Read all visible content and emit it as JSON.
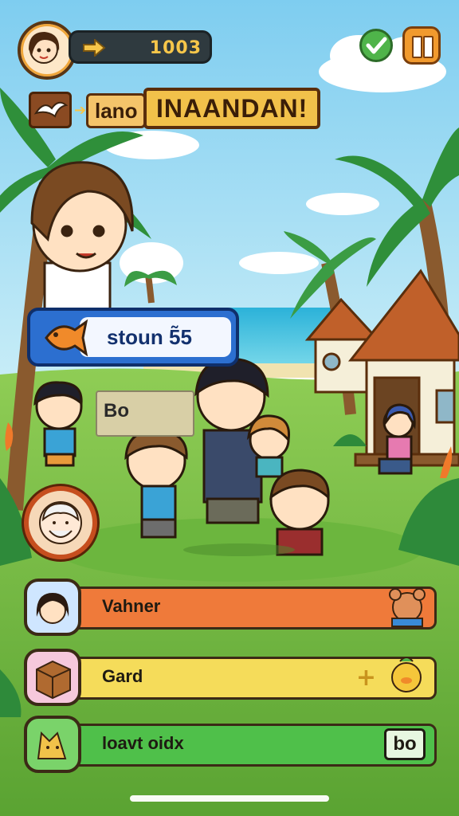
{
  "hud": {
    "coins": "1003",
    "arrow_icon": "arrow-right-icon",
    "confirm_icon": "check-icon",
    "pause_icon": "pause-icon"
  },
  "banner": {
    "subtitle": "lano",
    "title": "INAANDAN!"
  },
  "dialog": {
    "text": "stoun 5̃5"
  },
  "sign": {
    "text": "Bo"
  },
  "menu": [
    {
      "label": "Vahner",
      "icon": "girl-portrait-icon",
      "right_icon": "bear-icon",
      "color": "#ef7a3a"
    },
    {
      "label": "Gard",
      "icon": "crate-icon",
      "right_icon": "duck-icon",
      "badge_plus": "+",
      "color": "#f5dc5a"
    },
    {
      "label": "loavt oidx",
      "icon": "cat-icon",
      "badge": "bo",
      "color": "#4fc04a"
    }
  ],
  "colors": {
    "sky": "#8fd3f0",
    "grass": "#79c048",
    "accent_orange": "#f19a2e",
    "accent_blue": "#2c6fd0"
  }
}
